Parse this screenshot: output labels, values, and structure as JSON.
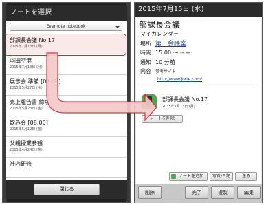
{
  "left": {
    "title": "ノートを選択",
    "notebook": "Evernote notebook",
    "notes": [
      {
        "title": "部課長会議 No.17",
        "date": "2015年7月13日 (月)"
      },
      {
        "title": "羽田空港",
        "date": "2015年7月13日 (月)"
      },
      {
        "title": "展示会 準備 [08:00]",
        "date": "2015年5月27日 (水)"
      },
      {
        "title": "売上報告書 締切",
        "date": "2015年5月23日 (金)"
      },
      {
        "title": "飲み会 [08:00]",
        "date": "2015年5月12日 (金)"
      },
      {
        "title": "父親授業参観",
        "date": "2015年4月24日 (金)"
      },
      {
        "title": "社内研修",
        "date": ""
      }
    ],
    "close_label": "閉じる"
  },
  "right": {
    "date_header": "2015年7月15日 (水)",
    "event_title": "部課長会議",
    "calendar_name": "マイカレンダー",
    "place_label": "場所",
    "place_value": "第一会議室",
    "time_label": "時間",
    "time_value": "15:00 〜 --:--",
    "notify_label": "通知",
    "notify_value": "10 分前",
    "content_label": "内容",
    "content_value": "参考サイト",
    "url": "http://www.jorte.com/",
    "linked_note": {
      "title": "部課長会議 No.17",
      "date": "2015年7月13日 (月)"
    },
    "delete_note_label": "ノートを削除",
    "add_note_label": "ノートを追加",
    "photo_label": "写真/日記",
    "send_label": "送る",
    "footer": {
      "delete": "削除",
      "done": "完了",
      "duplicate": "複製",
      "edit": "編集"
    }
  },
  "colors": {
    "highlight_border": "#c82b35",
    "arrow_fill": "#f6c9c9",
    "evernote_green": "#4fa84a",
    "link": "#1a3fb0"
  }
}
